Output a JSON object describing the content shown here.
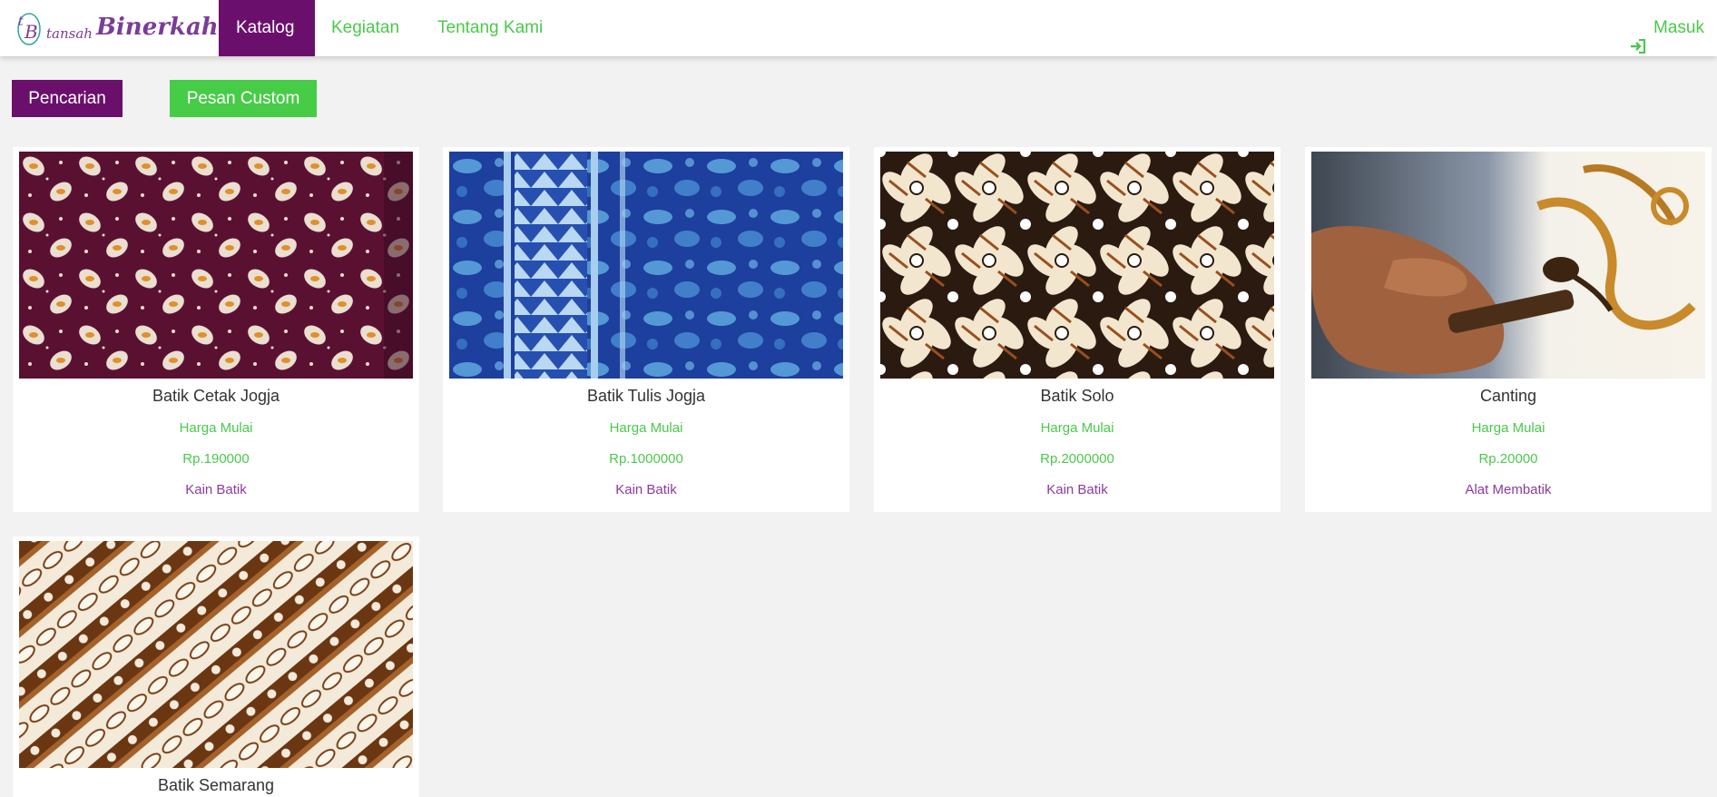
{
  "brand": {
    "mark": "tB",
    "small": "tansah",
    "big": "Binerkahan"
  },
  "nav": {
    "items": [
      "Katalog",
      "Kegiatan",
      "Tentang Kami"
    ],
    "login": "Masuk"
  },
  "buttons": {
    "search": "Pencarian",
    "custom": "Pesan Custom"
  },
  "products": [
    {
      "name": "Batik Cetak Jogja",
      "price_label": "Harga Mulai",
      "price": "Rp.190000",
      "category": "Kain Batik"
    },
    {
      "name": "Batik Tulis Jogja",
      "price_label": "Harga Mulai",
      "price": "Rp.1000000",
      "category": "Kain Batik"
    },
    {
      "name": "Batik Solo",
      "price_label": "Harga Mulai",
      "price": "Rp.2000000",
      "category": "Kain Batik"
    },
    {
      "name": "Canting",
      "price_label": "Harga Mulai",
      "price": "Rp.20000",
      "category": "Alat Membatik"
    },
    {
      "name": "Batik Semarang"
    }
  ],
  "colors": {
    "primary": "#6b0f6d",
    "accent": "#47cc47",
    "category": "#8e3aa0"
  }
}
